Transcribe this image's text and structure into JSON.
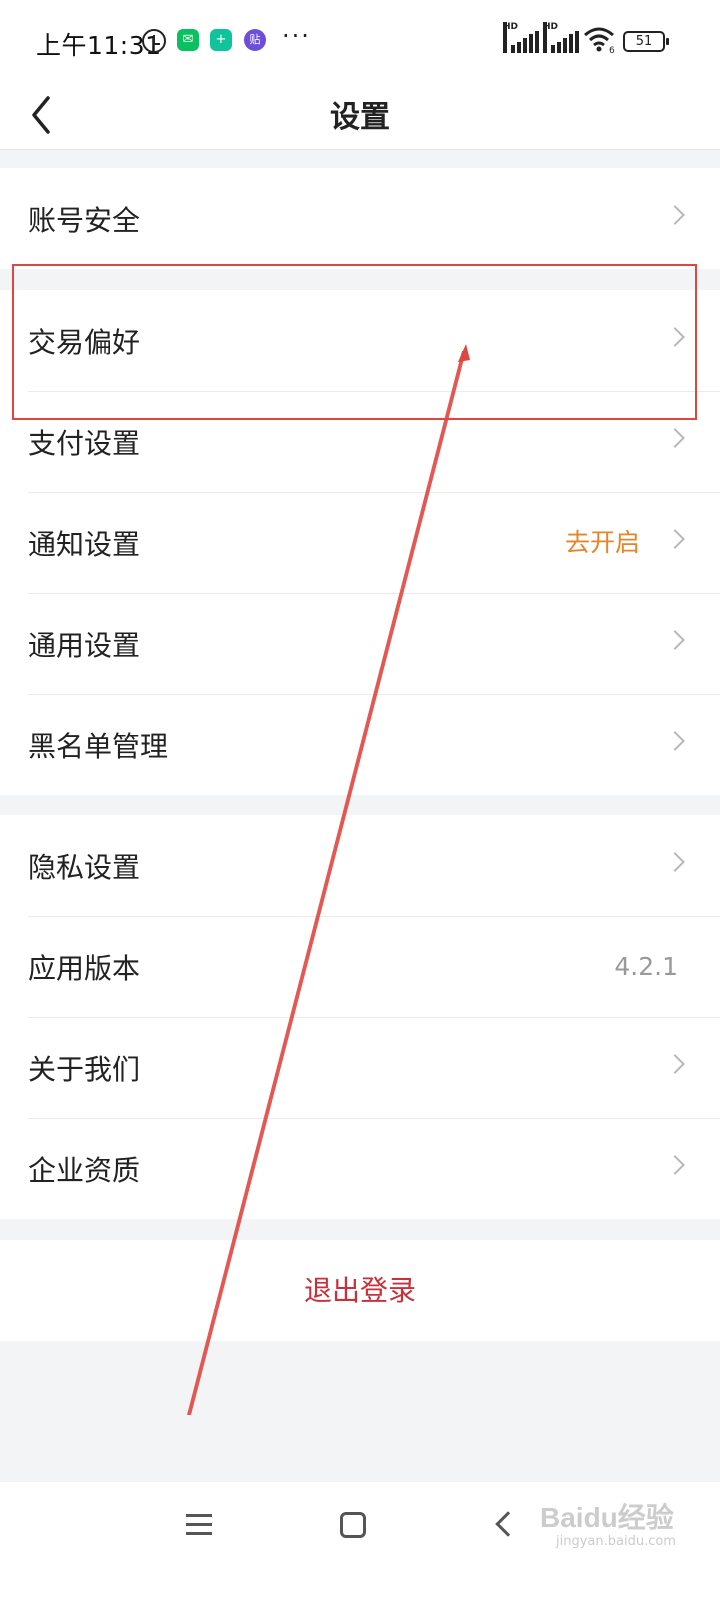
{
  "status_bar": {
    "time": "上午11:31",
    "icons": [
      "alarm-icon",
      "wechat-icon",
      "shield-app-icon",
      "sticker-app-icon",
      "more-dots-icon",
      "hd-signal-icon",
      "hd-signal-icon",
      "wifi-icon",
      "battery-icon"
    ],
    "battery_level": "51",
    "dots": "···",
    "hd": "HD",
    "wifi_badge": "6",
    "app_badges": {
      "wechat": "✉",
      "shield": "+",
      "sticker": "贴"
    }
  },
  "header": {
    "title": "设置"
  },
  "groups": [
    [
      {
        "label": "账号安全"
      }
    ],
    [
      {
        "label": "交易偏好"
      },
      {
        "label": "支付设置"
      },
      {
        "label": "通知设置",
        "value": "去开启"
      },
      {
        "label": "通用设置"
      },
      {
        "label": "黑名单管理"
      }
    ],
    [
      {
        "label": "隐私设置"
      },
      {
        "label": "应用版本",
        "value": "4.2.1"
      },
      {
        "label": "关于我们"
      },
      {
        "label": "企业资质"
      }
    ]
  ],
  "logout_label": "退出登录",
  "watermark": {
    "logo": "Baidu经验",
    "sub": "jingyan.baidu.com"
  },
  "colors": {
    "accent_orange": "#e5852a",
    "logout_red": "#c9303b",
    "annotation_red": "#e0463f"
  }
}
